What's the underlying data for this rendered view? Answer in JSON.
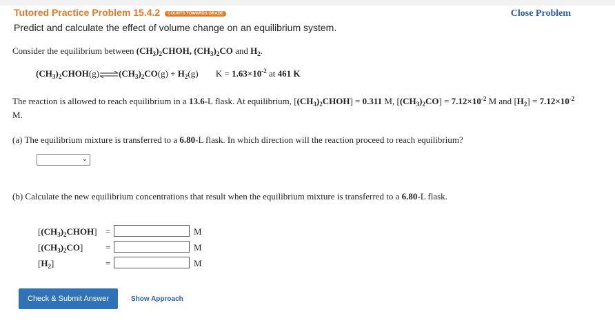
{
  "header": {
    "title": "Tutored Practice Problem 15.4.2",
    "badge": "COUNTS TOWARDS GRADE",
    "subtitle": "Predict and calculate the effect of volume change on an equilibrium system.",
    "close_label": "Close Problem"
  },
  "intro": {
    "text": "Consider the equilibrium between",
    "and": "and"
  },
  "equation": {
    "k_label": "K =",
    "k_value": "1.63×10",
    "k_exp": "-2",
    "temp_prefix": "at",
    "temp_value": "461 K"
  },
  "statement": {
    "line1_a": "The reaction is allowed to reach equilibrium in a",
    "volume1": "13.6",
    "line1_b": "-L flask. At equilibrium,",
    "c1": "0.311",
    "c2": "7.12×10",
    "c2_exp": "-2",
    "c3": "7.12×10",
    "c3_exp": "-2",
    "unit_M": "M",
    "and": "and"
  },
  "part_a": {
    "text_a": "(a) The equilibrium mixture is transferred to a",
    "volume": "6.80",
    "text_b": "-L flask. In which direction will the reaction proceed to reach equilibrium?",
    "select_value": ""
  },
  "part_b": {
    "text_a": "(b) Calculate the new equilibrium concentrations that result when the equilibrium mixture is transferred to a",
    "volume": "6.80",
    "text_b": "-L flask.",
    "unit": "M"
  },
  "buttons": {
    "submit_label": "Check & Submit Answer",
    "approach_label": "Show Approach"
  },
  "colors": {
    "title_orange": "#e87722",
    "link_blue": "#2a5db0",
    "button_blue": "#2f72b8"
  }
}
